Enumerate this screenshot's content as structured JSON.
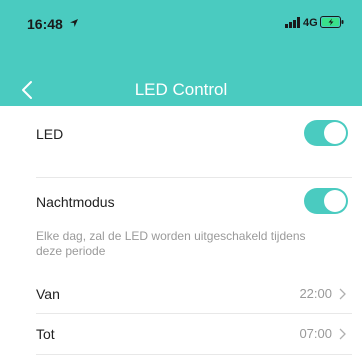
{
  "statusbar": {
    "time": "16:48",
    "network": "4G",
    "icons": [
      "location-arrow-icon",
      "signal-bars-icon",
      "battery-icon"
    ]
  },
  "header": {
    "title": "LED Control",
    "back_icon": "chevron-left-icon"
  },
  "settings": {
    "led": {
      "label": "LED",
      "enabled": true
    },
    "night_mode": {
      "label": "Nachtmodus",
      "enabled": true,
      "description": "Elke dag, zal de LED worden uitgeschakeld tijdens deze periode"
    },
    "from": {
      "label": "Van",
      "value": "22:00"
    },
    "to": {
      "label": "Tot",
      "value": "07:00"
    }
  },
  "colors": {
    "accent": "#4acbc0",
    "muted_text": "#9a9a9a",
    "battery": "#39e08a"
  }
}
